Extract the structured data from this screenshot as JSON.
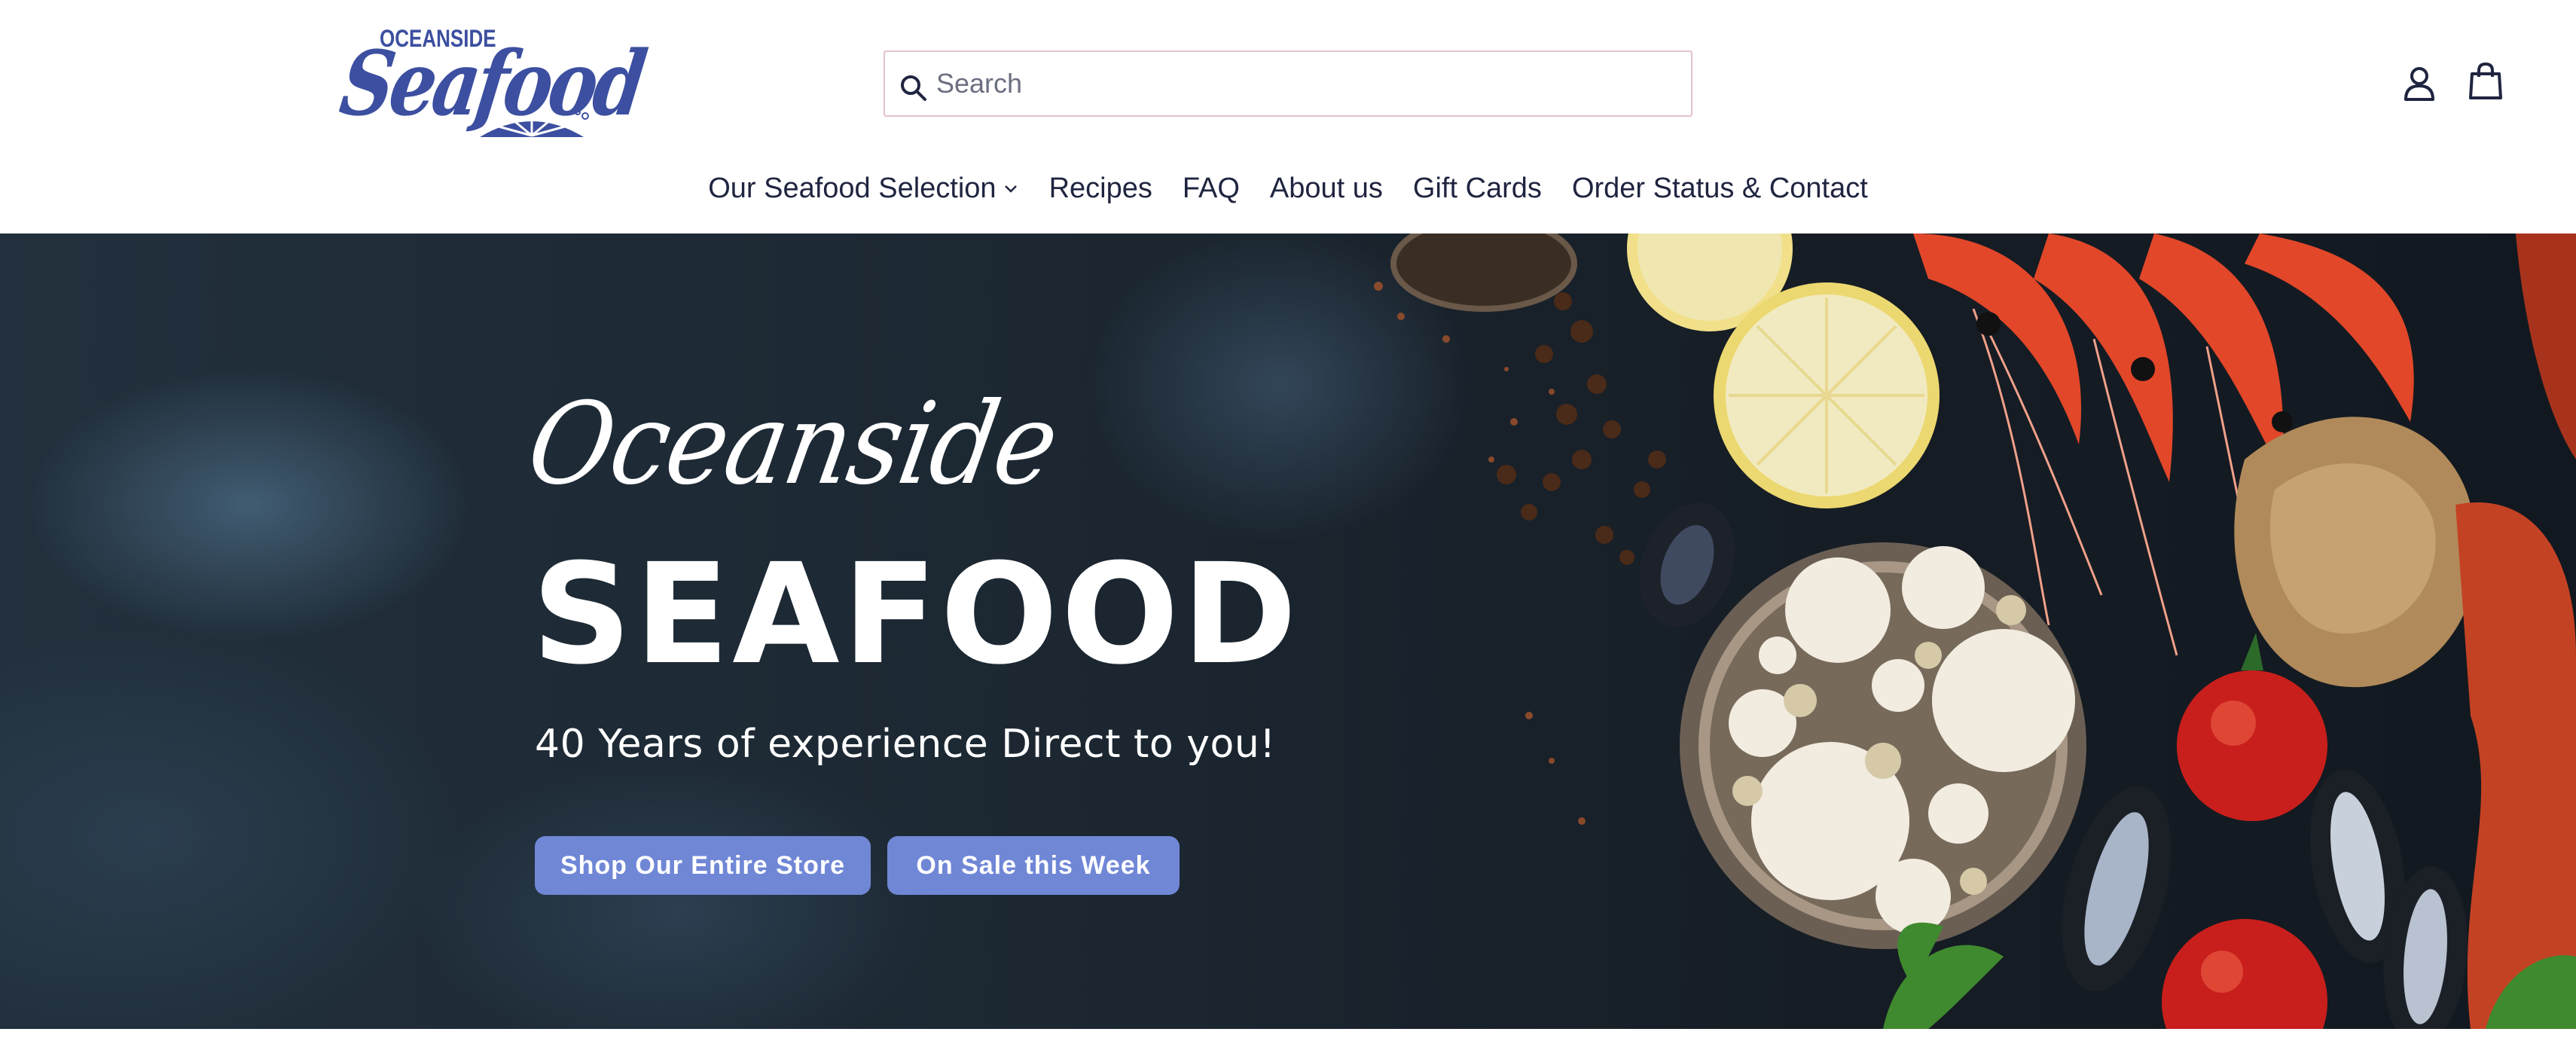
{
  "header": {
    "logo": {
      "small_text": "OCEANSIDE",
      "big_text": "Seafood",
      "color": "#3c4fa0"
    },
    "search": {
      "placeholder": "Search",
      "value": ""
    },
    "icons": {
      "search": "search-icon",
      "account": "account-icon",
      "cart": "cart-icon"
    }
  },
  "nav": {
    "items": [
      {
        "label": "Our Seafood Selection",
        "has_dropdown": true
      },
      {
        "label": "Recipes"
      },
      {
        "label": "FAQ"
      },
      {
        "label": "About us"
      },
      {
        "label": "Gift Cards"
      },
      {
        "label": "Order Status & Contact"
      }
    ]
  },
  "hero": {
    "script_title": "Oceanside",
    "title": "SEAFOOD",
    "subtitle": "40 Years of experience Direct to you!",
    "buttons": {
      "shop": "Shop Our Entire Store",
      "sale": "On Sale this Week"
    },
    "button_color": "#7087d6"
  }
}
